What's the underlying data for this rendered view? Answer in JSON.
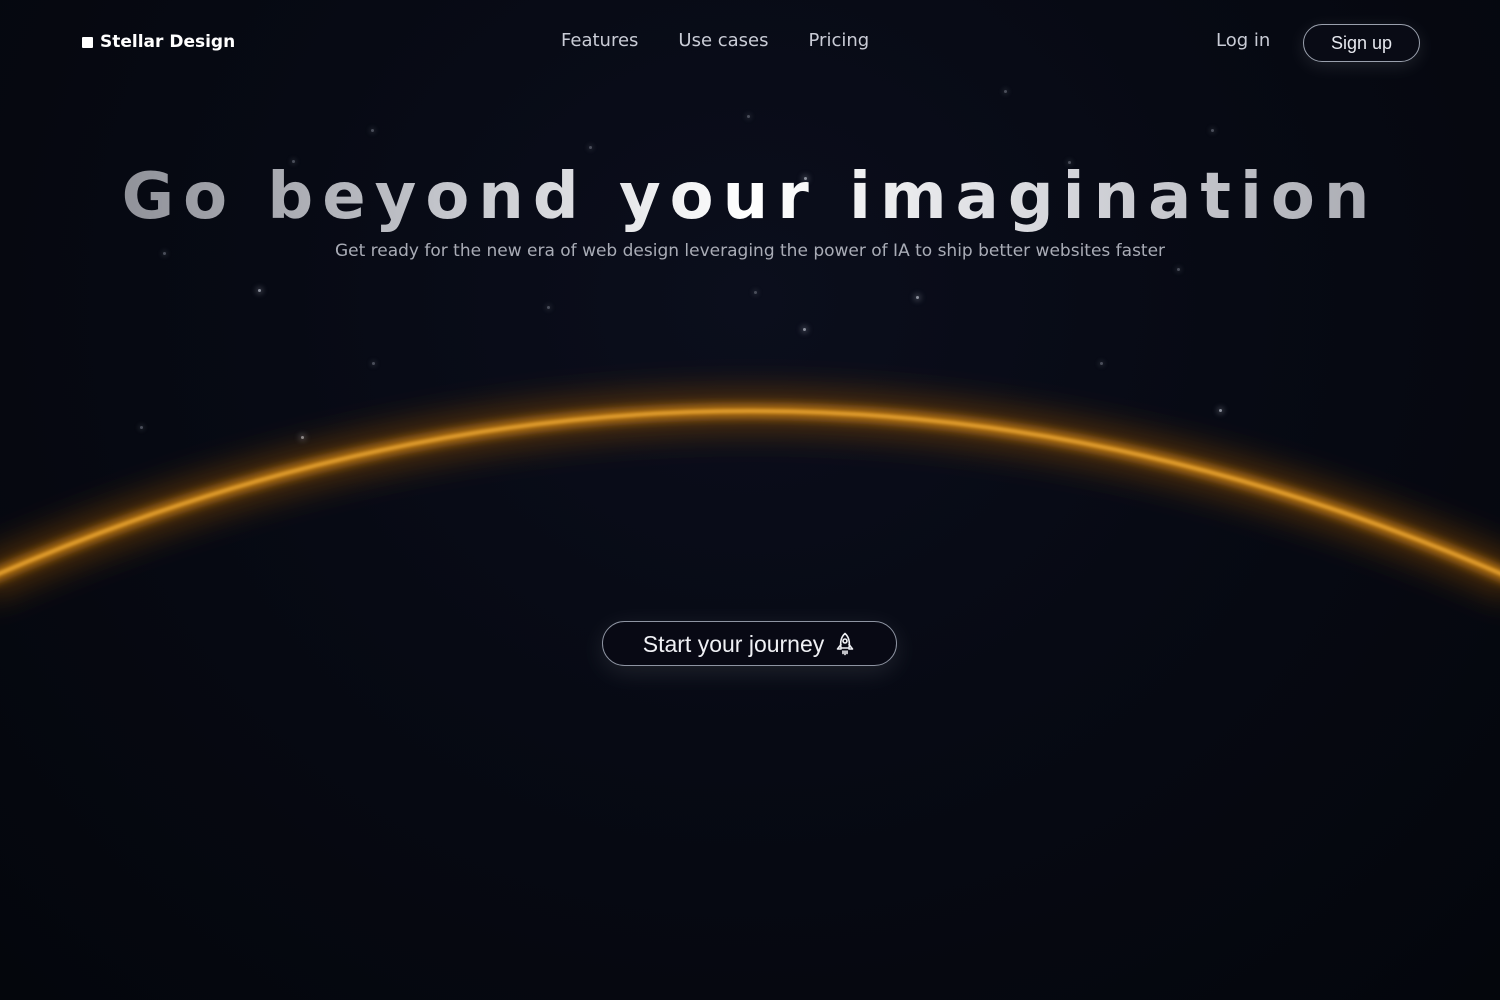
{
  "brand": {
    "name": "Stellar Design"
  },
  "nav": {
    "links": [
      {
        "label": "Features"
      },
      {
        "label": "Use cases"
      },
      {
        "label": "Pricing"
      }
    ],
    "login_label": "Log in",
    "signup_label": "Sign up"
  },
  "hero": {
    "title": "Go beyond your imagination",
    "subtitle": "Get ready for the new era of web design leveraging the power of IA to ship better websites faster",
    "cta_label": "Start your journey",
    "cta_icon": "rocket-icon"
  },
  "colors": {
    "background": "#05070f",
    "horizon_glow": "#f0a020",
    "text_primary": "#ffffff",
    "text_muted": "#a9acb6"
  }
}
